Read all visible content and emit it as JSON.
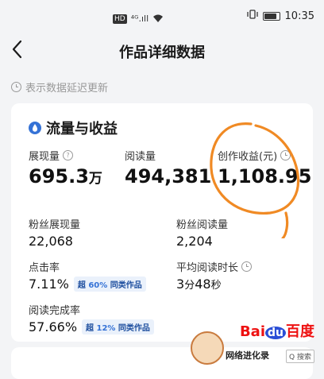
{
  "status_bar": {
    "hd_badge": "HD",
    "signal_text": "⁴ᴳ.ıll",
    "time": "10:35"
  },
  "nav": {
    "title": "作品详细数据"
  },
  "notice": {
    "text": "表示数据延迟更新"
  },
  "section": {
    "title": "流量与收益"
  },
  "stats": {
    "impressions": {
      "label": "展现量",
      "value": "695.3",
      "unit": "万"
    },
    "reads": {
      "label": "阅读量",
      "value": "494,381"
    },
    "earnings": {
      "label": "创作收益(元)",
      "value": "1,108.95"
    },
    "fan_impressions": {
      "label": "粉丝展现量",
      "value": "22,068"
    },
    "fan_reads": {
      "label": "粉丝阅读量",
      "value": "2,204"
    },
    "ctr": {
      "label": "点击率",
      "value": "7.11",
      "unit": "%",
      "badge_prefix": "超",
      "badge_pct": "60%",
      "badge_suffix": "同类作品"
    },
    "avg_read_time": {
      "label": "平均阅读时长",
      "minutes": "3",
      "min_unit": "分",
      "seconds": "48",
      "sec_unit": "秒"
    },
    "completion_rate": {
      "label": "阅读完成率",
      "value": "57.66",
      "unit": "%",
      "badge_prefix": "超",
      "badge_pct": "12%",
      "badge_suffix": "同类作品"
    }
  },
  "watermark": {
    "logo_bai": "Bai",
    "logo_du": "du",
    "logo_baidu": "百度",
    "sub_text": "网络进化录",
    "search_text": "Q 搜索"
  },
  "colors": {
    "accent_blue": "#3572d6",
    "annotation_orange": "#f08a24",
    "background": "#f3f4f6"
  }
}
